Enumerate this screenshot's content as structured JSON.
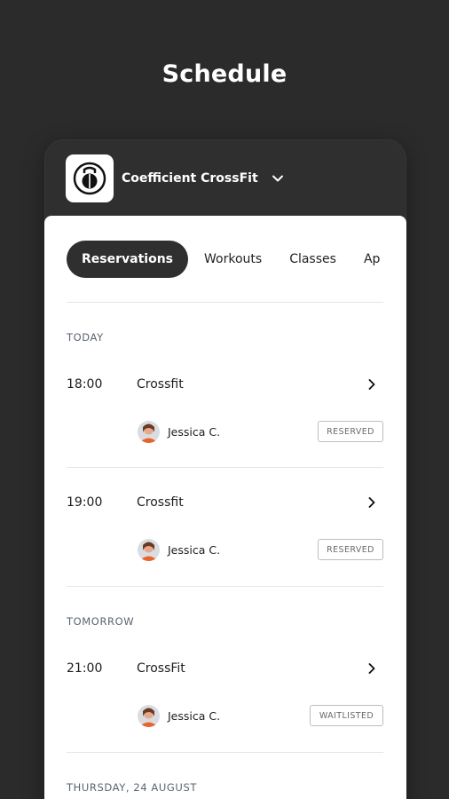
{
  "page": {
    "title": "Schedule"
  },
  "header": {
    "gym_name": "Coefficient CrossFit",
    "logo_icon": "kettlebell-icon",
    "dropdown_icon": "chevron-down-icon"
  },
  "tabs": [
    {
      "label": "Reservations",
      "active": true
    },
    {
      "label": "Workouts",
      "active": false
    },
    {
      "label": "Classes",
      "active": false
    },
    {
      "label": "Ap",
      "active": false
    }
  ],
  "sections": [
    {
      "label": "TODAY",
      "items": [
        {
          "time": "18:00",
          "class": "Crossfit",
          "coach": "Jessica C.",
          "status": "RESERVED"
        },
        {
          "time": "19:00",
          "class": "Crossfit",
          "coach": "Jessica C.",
          "status": "RESERVED"
        }
      ]
    },
    {
      "label": "TOMORROW",
      "items": [
        {
          "time": "21:00",
          "class": "CrossFit",
          "coach": "Jessica C.",
          "status": "WAITLISTED"
        }
      ]
    },
    {
      "label": "THURSDAY, 24 AUGUST",
      "items": []
    }
  ],
  "colors": {
    "background": "#2b2b2b",
    "active_tab": "#2f2f2f",
    "text": "#1d1d1d",
    "section_label": "#5a6472",
    "badge_border": "#bdbdbd"
  }
}
